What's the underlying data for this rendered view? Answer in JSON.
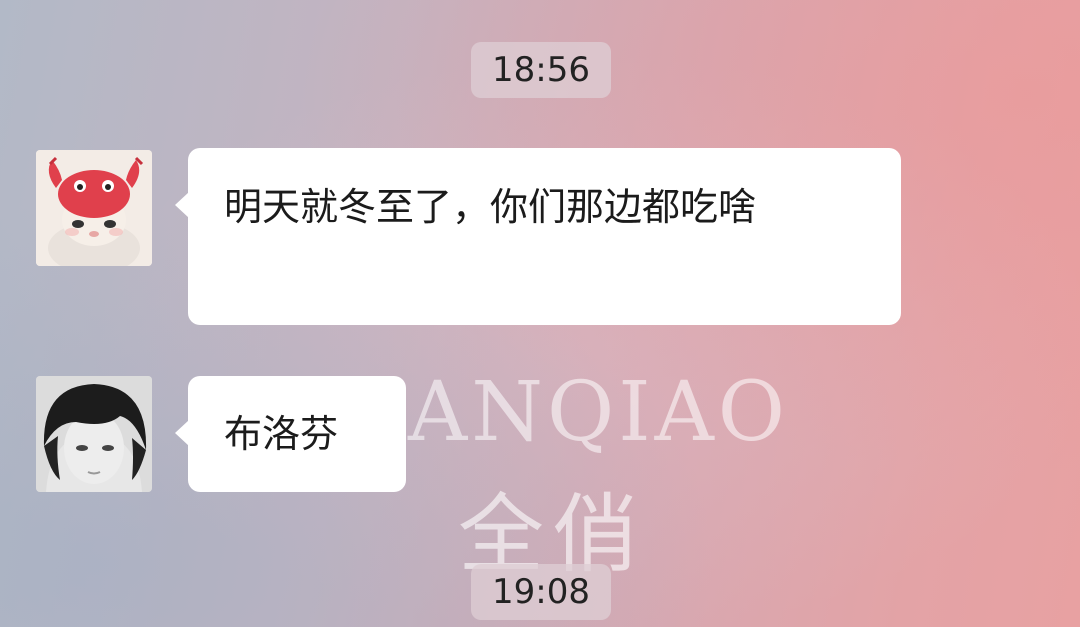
{
  "chat": {
    "timestamps": [
      "18:56",
      "19:08"
    ],
    "messages": [
      {
        "avatar": "crab-hat-cat-avatar",
        "text": "明天就冬至了，你们那边都吃啥"
      },
      {
        "avatar": "boy-portrait-avatar",
        "text": "布洛芬"
      }
    ]
  },
  "watermark": {
    "latin": "ANQIAO",
    "cjk": "全俏"
  },
  "colors": {
    "bubble": "#ffffff",
    "timestamp_bg": "#decdd4",
    "text": "#1b1b1b"
  }
}
